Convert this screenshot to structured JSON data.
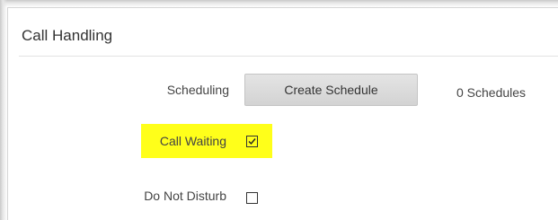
{
  "section": {
    "title": "Call Handling"
  },
  "scheduling": {
    "label": "Scheduling",
    "button_label": "Create Schedule",
    "count_text": "0 Schedules"
  },
  "call_waiting": {
    "label": "Call Waiting",
    "checked": true
  },
  "do_not_disturb": {
    "label": "Do Not Disturb",
    "checked": false
  },
  "colors": {
    "highlight": "#ffff1a",
    "button_bg": "#d9d9d9",
    "text": "#444444"
  },
  "icons": {
    "checkmark": "checkmark-icon"
  }
}
